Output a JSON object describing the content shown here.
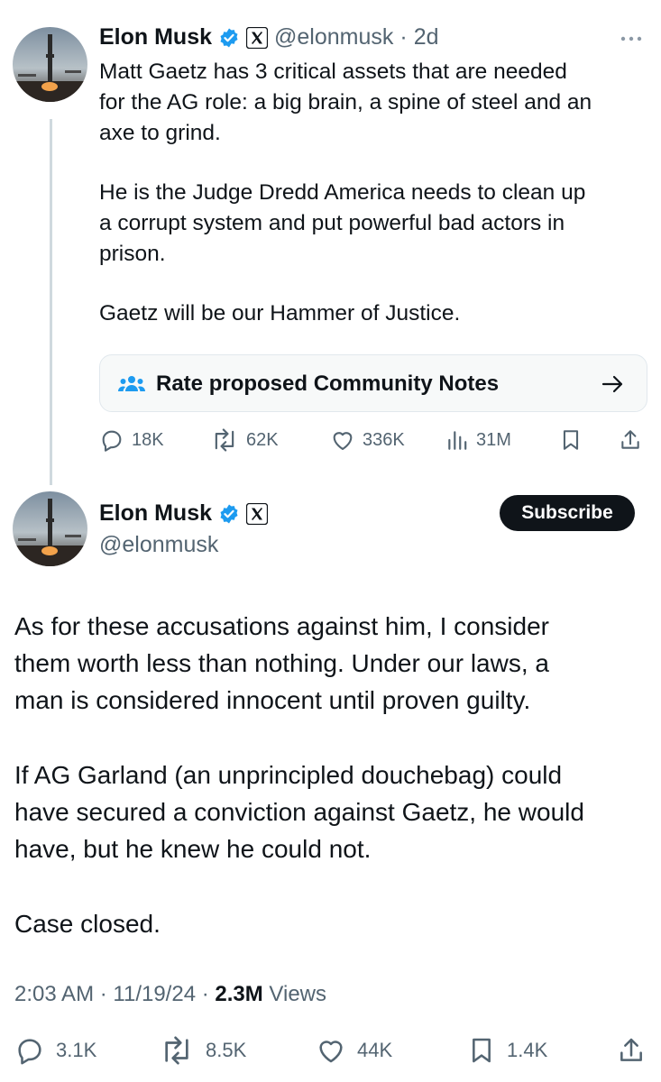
{
  "quoted_tweet": {
    "name": "Elon Musk",
    "handle": "@elonmusk",
    "separator": "·",
    "time": "2d",
    "paragraphs": [
      "Matt Gaetz has 3 critical assets that are needed\nfor the AG role: a big brain, a spine of steel and an\naxe to grind.",
      "He is the Judge Dredd America needs to clean up\na corrupt system and put powerful bad actors in\nprison.",
      "Gaetz will be our Hammer of Justice."
    ],
    "community_notes_label": "Rate proposed Community Notes",
    "metrics": {
      "replies": "18K",
      "reposts": "62K",
      "likes": "336K",
      "views": "31M"
    }
  },
  "main_tweet": {
    "name": "Elon Musk",
    "handle": "@elonmusk",
    "subscribe_label": "Subscribe",
    "paragraphs": [
      "As for these accusations against him, I consider\nthem worth less than nothing. Under our laws, a\nman is considered innocent until proven guilty.",
      "If AG Garland (an unprincipled douchebag) could\nhave secured a conviction against Gaetz, he would\nhave, but he knew he could not.",
      "Case closed."
    ],
    "time": "2:03 AM",
    "date": "11/19/24",
    "separator": "·",
    "views_count": "2.3M",
    "views_label": "Views",
    "metrics": {
      "replies": "3.1K",
      "reposts": "8.5K",
      "likes": "44K",
      "bookmarks": "1.4K"
    }
  },
  "colors": {
    "verified": "#1d9bf0",
    "text": "#0f1419",
    "muted": "#536471",
    "notes_icon": "#1d9bf0"
  },
  "icons": [
    "verified-badge-icon",
    "x-logo-icon",
    "more-icon",
    "community-notes-icon",
    "arrow-right-icon",
    "reply-icon",
    "repost-icon",
    "like-icon",
    "views-icon",
    "bookmark-icon",
    "share-icon"
  ]
}
